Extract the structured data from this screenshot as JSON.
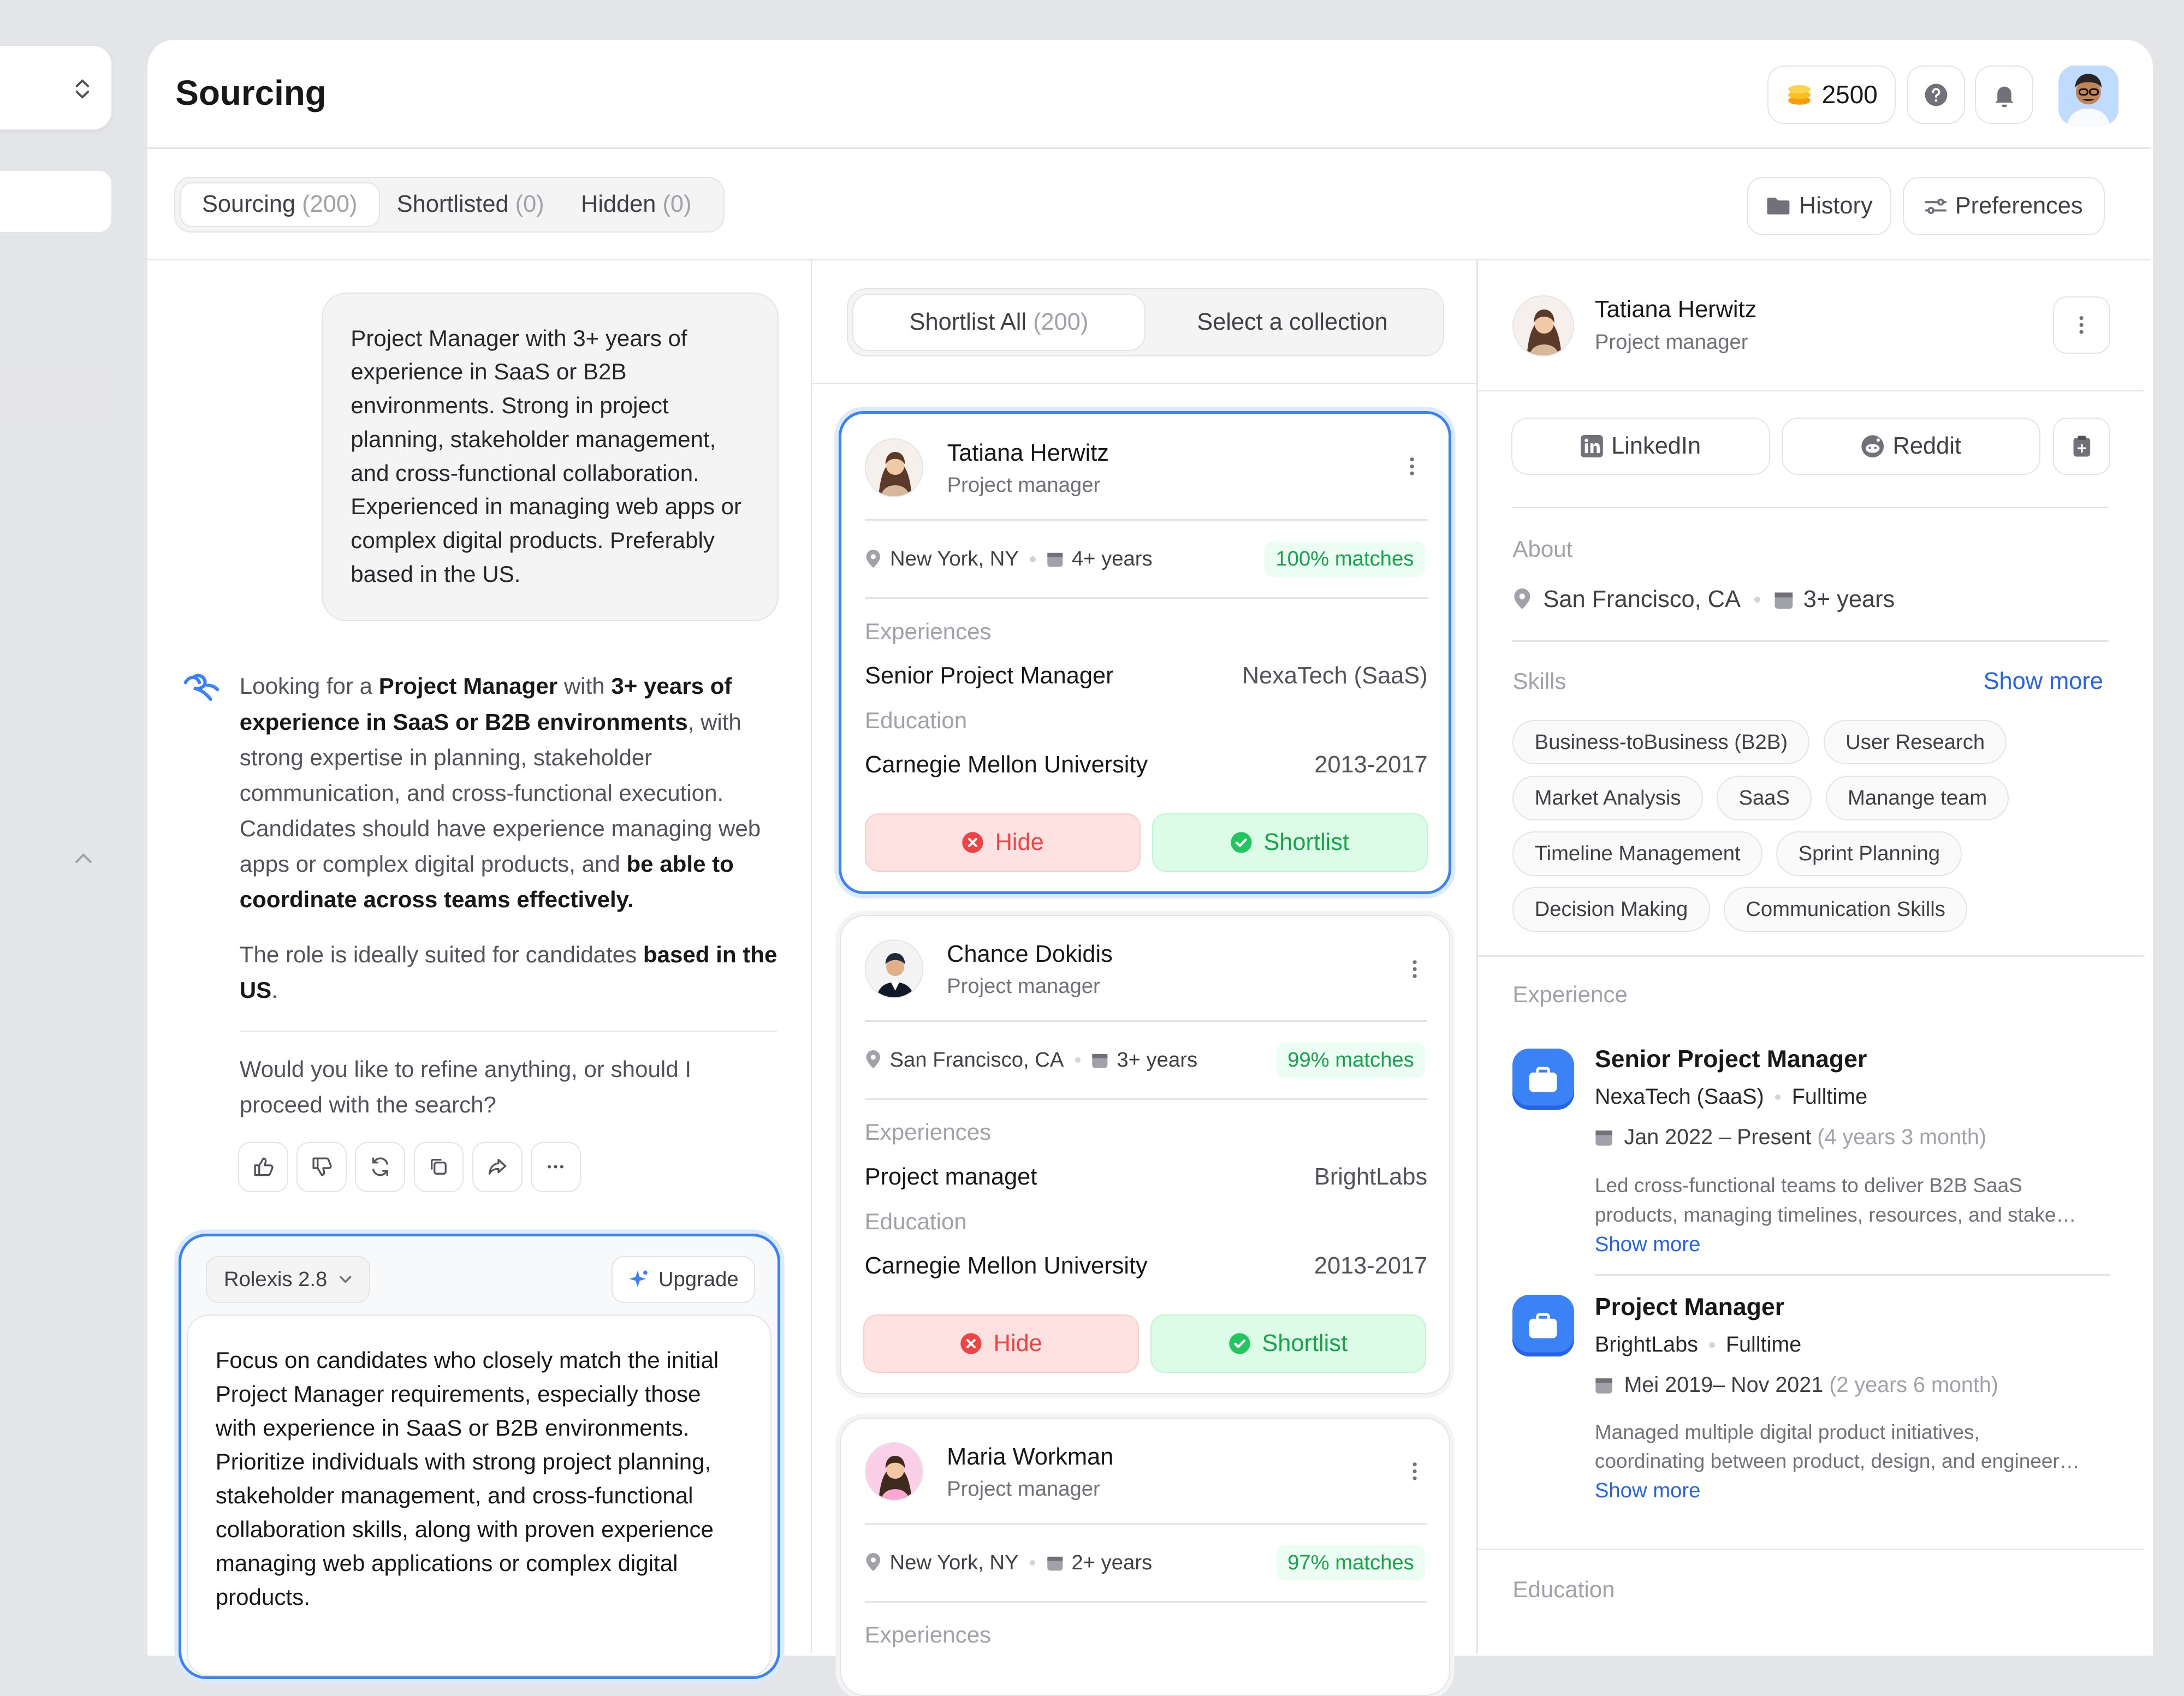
{
  "header": {
    "title": "Sourcing",
    "credits": "2500"
  },
  "tabs": [
    {
      "label": "Sourcing",
      "count": "(200)"
    },
    {
      "label": "Shortlisted",
      "count": "(0)"
    },
    {
      "label": "Hidden",
      "count": "(0)"
    }
  ],
  "toolbar": {
    "history": "History",
    "preferences": "Preferences"
  },
  "chat": {
    "user_message": "Project Manager with 3+ years of experience in SaaS or B2B environments. Strong in project planning, stakeholder management, and cross-functional collaboration. Experienced in managing web apps or complex digital products. Preferably based in the US.",
    "reply_p1_a": "Looking for a ",
    "reply_p1_b": "Project Manager",
    "reply_p1_c": " with ",
    "reply_p1_d": "3+ years of experience in SaaS or B2B environments",
    "reply_p1_e": ", with strong expertise in planning, stakeholder communication, and cross-functional execution. Candidates should have experience managing web apps or complex digital products, and ",
    "reply_p1_f": "be able to coordinate across teams effectively.",
    "reply_p2_a": "The role is ideally suited for candidates ",
    "reply_p2_b": "based in the US",
    "reply_p2_c": ".",
    "reply_question": "Would you like to refine anything, or should I proceed with the search?",
    "composer": {
      "model": "Rolexis 2.8",
      "upgrade": "Upgrade",
      "text": "Focus on candidates who closely match the initial Project Manager requirements, especially those with experience in SaaS or B2B environments. Prioritize individuals with strong project planning, stakeholder management, and cross-functional collaboration skills, along with proven experience managing web applications or complex digital products."
    }
  },
  "candidates_header": {
    "shortlist_all": "Shortlist All",
    "shortlist_count": "(200)",
    "select_collection": "Select a collection"
  },
  "candidates": [
    {
      "name": "Tatiana Herwitz",
      "role": "Project manager",
      "location": "New York, NY",
      "years": "4+ years",
      "match": "100% matches",
      "exp_label": "Experiences",
      "exp_title": "Senior Project Manager",
      "exp_company": "NexaTech (SaaS)",
      "edu_label": "Education",
      "edu_school": "Carnegie Mellon University",
      "edu_years": "2013-2017",
      "hide": "Hide",
      "shortlist": "Shortlist"
    },
    {
      "name": "Chance Dokidis",
      "role": "Project manager",
      "location": "San Francisco, CA",
      "years": "3+ years",
      "match": "99% matches",
      "exp_label": "Experiences",
      "exp_title": "Project managet",
      "exp_company": "BrightLabs",
      "edu_label": "Education",
      "edu_school": "Carnegie Mellon University",
      "edu_years": "2013-2017",
      "hide": "Hide",
      "shortlist": "Shortlist"
    },
    {
      "name": "Maria Workman",
      "role": "Project manager",
      "location": "New York, NY",
      "years": "2+ years",
      "match": "97% matches",
      "exp_label": "Experiences"
    }
  ],
  "profile": {
    "name": "Tatiana Herwitz",
    "role": "Project manager",
    "linkedin": "LinkedIn",
    "reddit": "Reddit",
    "about_label": "About",
    "location": "San Francisco, CA",
    "years": "3+ years",
    "skills_label": "Skills",
    "show_more": "Show more",
    "skills": [
      "Business-toBusiness (B2B)",
      "User Research",
      "Market Analysis",
      "SaaS",
      "Manange team",
      "Timeline Management",
      "Sprint Planning",
      "Decision Making",
      "Communication Skills"
    ],
    "experience_label": "Experience",
    "experience": [
      {
        "title": "Senior Project Manager",
        "company": "NexaTech (SaaS)",
        "type": "Fulltime",
        "dates": "Jan 2022 – Present",
        "duration": "(4 years 3 month)",
        "desc1": "Led cross-functional teams to deliver B2B SaaS",
        "desc2": "products, managing timelines, resources, and stake…",
        "more": "Show more"
      },
      {
        "title": "Project Manager",
        "company": "BrightLabs",
        "type": "Fulltime",
        "dates": "Mei 2019– Nov 2021",
        "duration": "(2 years 6 month)",
        "desc1": "Managed multiple digital product initiatives,",
        "desc2": "coordinating between product, design, and engineer…",
        "more": "Show more"
      }
    ],
    "education_label": "Education"
  },
  "colors": {
    "accent": "#3b82f6",
    "match_green": "#16a34a",
    "hide_red": "#ef4444"
  },
  "icons": [
    "chevron-updown-icon",
    "chevron-up-icon",
    "coins-icon",
    "help-icon",
    "bell-icon",
    "folder-icon",
    "sliders-icon",
    "sparkle-logo-icon",
    "thumbs-up-icon",
    "thumbs-down-icon",
    "refresh-icon",
    "copy-icon",
    "share-icon",
    "more-icon",
    "pin-icon",
    "calendar-icon",
    "x-circle-icon",
    "check-circle-icon",
    "linkedin-icon",
    "reddit-icon",
    "clipboard-icon",
    "briefcase-icon"
  ]
}
